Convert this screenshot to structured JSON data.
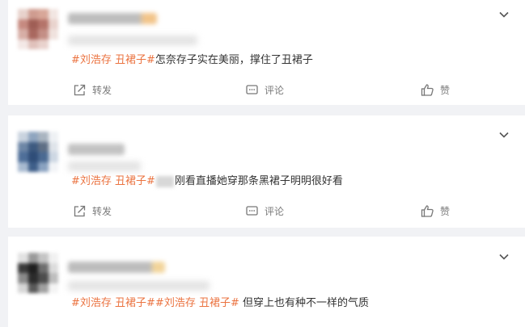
{
  "icons": {
    "chevron": "chevron-down-icon",
    "share": "share-icon",
    "comment": "comment-icon",
    "like": "thumbs-up-icon"
  },
  "colors": {
    "tag": "#eb7340",
    "text": "#333333",
    "meta": "#7a7a7a",
    "background": "#f1f2f5"
  },
  "posts": [
    {
      "segments": [
        {
          "text": "#刘浩存 丑裙子#",
          "style": "tag"
        },
        {
          "text": "怎奈存子实在美丽，撑住了丑裙子",
          "style": "plain"
        }
      ],
      "actions": {
        "share": "转发",
        "comment": "评论",
        "like": "赞"
      }
    },
    {
      "segments": [
        {
          "text": "#刘浩存 丑裙子#",
          "style": "tag"
        },
        {
          "text": "刚看直播她穿那条黑裙子明明很好看",
          "style": "plain"
        }
      ],
      "actions": {
        "share": "转发",
        "comment": "评论",
        "like": "赞"
      }
    },
    {
      "segments": [
        {
          "text": "#刘浩存 丑裙子#",
          "style": "tag"
        },
        {
          "text": "#刘浩存 丑裙子#",
          "style": "tag"
        },
        {
          "text": " 但穿上也有种不一样的气质",
          "style": "plain"
        }
      ]
    }
  ]
}
